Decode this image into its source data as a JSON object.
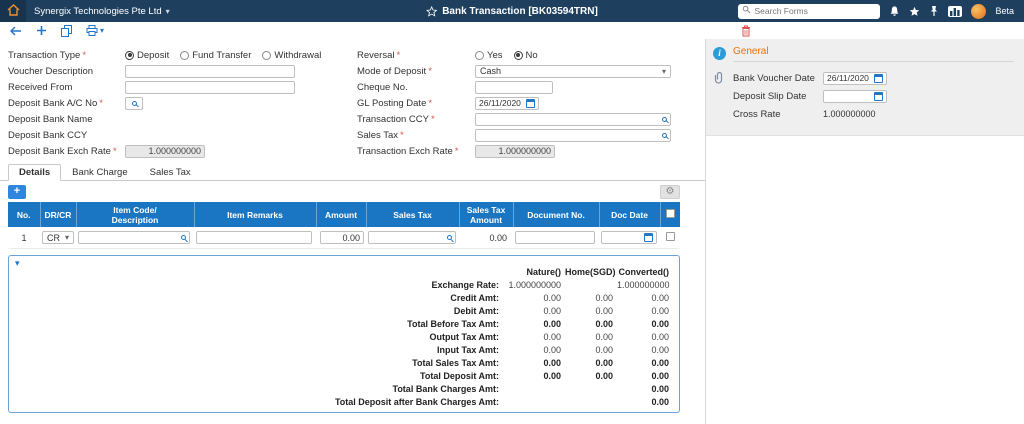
{
  "topbar": {
    "company": "Synergix Technologies Pte Ltd",
    "title": "Bank Transaction [BK03594TRN]",
    "search_placeholder": "Search Forms",
    "user_label": "Beta"
  },
  "ui": {
    "required_marker": "*",
    "caret_down": "▾",
    "plus": "+",
    "gear": "⚙",
    "collapse_arrow": "▾",
    "info_glyph": "i"
  },
  "form": {
    "transaction_type": {
      "label": "Transaction Type",
      "options": [
        "Deposit",
        "Fund Transfer",
        "Withdrawal"
      ],
      "selected": "Deposit"
    },
    "voucher_description": {
      "label": "Voucher Description",
      "value": ""
    },
    "received_from": {
      "label": "Received From",
      "value": ""
    },
    "deposit_bank_ac_no": {
      "label": "Deposit Bank A/C No",
      "value": ""
    },
    "deposit_bank_name": {
      "label": "Deposit Bank Name",
      "value": ""
    },
    "deposit_bank_ccy": {
      "label": "Deposit Bank CCY",
      "value": ""
    },
    "deposit_bank_exch_rate": {
      "label": "Deposit Bank Exch Rate",
      "value": "1.000000000"
    },
    "reversal": {
      "label": "Reversal",
      "options": [
        "Yes",
        "No"
      ],
      "selected": "No"
    },
    "mode_of_deposit": {
      "label": "Mode of Deposit",
      "value": "Cash"
    },
    "cheque_no": {
      "label": "Cheque No.",
      "value": ""
    },
    "gl_posting_date": {
      "label": "GL Posting Date",
      "value": "26/11/2020"
    },
    "transaction_ccy": {
      "label": "Transaction CCY",
      "value": ""
    },
    "sales_tax": {
      "label": "Sales Tax",
      "value": ""
    },
    "transaction_exch_rate": {
      "label": "Transaction Exch Rate",
      "value": "1.000000000"
    }
  },
  "side_panel": {
    "section_title": "General",
    "bank_voucher_date": {
      "label": "Bank Voucher Date",
      "value": "26/11/2020"
    },
    "deposit_slip_date": {
      "label": "Deposit Slip Date",
      "value": ""
    },
    "cross_rate": {
      "label": "Cross Rate",
      "value": "1.000000000"
    }
  },
  "tabs": [
    {
      "label": "Details"
    },
    {
      "label": "Bank Charge"
    },
    {
      "label": "Sales Tax"
    }
  ],
  "items_table": {
    "headers": {
      "no": "No.",
      "drcr": "DR/CR",
      "item_code": "Item Code/\nDescription",
      "item_remarks": "Item Remarks",
      "amount": "Amount",
      "sales_tax": "Sales Tax",
      "sales_tax_amount": "Sales Tax\nAmount",
      "document_no": "Document No.",
      "doc_date": "Doc Date"
    },
    "rows": [
      {
        "no": "1",
        "drcr": "CR",
        "item_code": "",
        "item_remarks": "",
        "amount": "0.00",
        "sales_tax": "",
        "sales_tax_amount": "0.00",
        "document_no": "",
        "doc_date": ""
      }
    ]
  },
  "summary": {
    "columns": [
      "Nature()",
      "Home(SGD)",
      "Converted()"
    ],
    "rows": [
      {
        "label": "Exchange Rate:",
        "nature": "1.000000000",
        "home": "",
        "converted": "1.000000000"
      },
      {
        "label": "Credit Amt:",
        "nature": "0.00",
        "home": "0.00",
        "converted": "0.00"
      },
      {
        "label": "Debit Amt:",
        "nature": "0.00",
        "home": "0.00",
        "converted": "0.00"
      },
      {
        "label": "Total Before Tax Amt:",
        "nature": "0.00",
        "home": "0.00",
        "converted": "0.00"
      },
      {
        "label": "Output Tax Amt:",
        "nature": "0.00",
        "home": "0.00",
        "converted": "0.00"
      },
      {
        "label": "Input Tax Amt:",
        "nature": "0.00",
        "home": "0.00",
        "converted": "0.00"
      },
      {
        "label": "Total Sales Tax Amt:",
        "nature": "0.00",
        "home": "0.00",
        "converted": "0.00"
      },
      {
        "label": "Total Deposit Amt:",
        "nature": "0.00",
        "home": "0.00",
        "converted": "0.00"
      },
      {
        "label": "Total Bank Charges Amt:",
        "nature": "",
        "home": "",
        "converted": "0.00"
      },
      {
        "label": "Total Deposit after Bank Charges Amt:",
        "nature": "",
        "home": "",
        "converted": "0.00"
      }
    ]
  }
}
